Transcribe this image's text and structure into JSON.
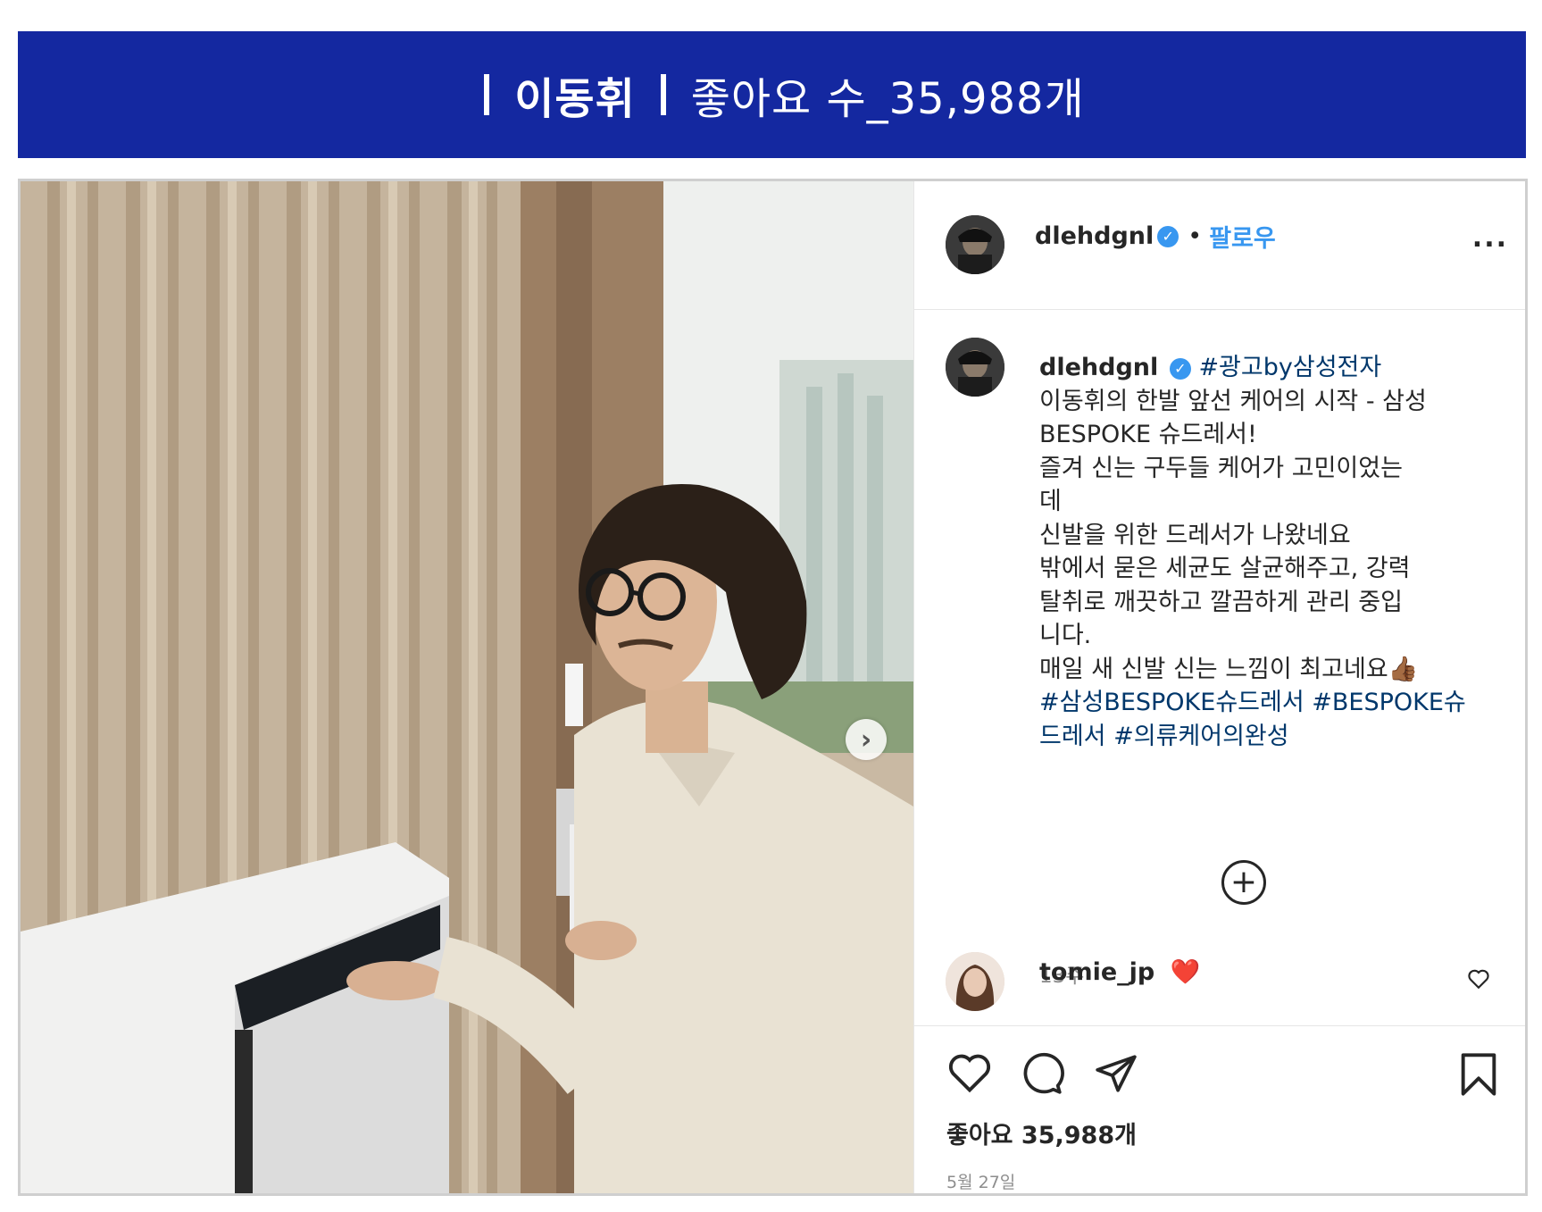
{
  "banner": {
    "name": "이동휘",
    "likes_text": "좋아요 수_35,988개"
  },
  "post": {
    "username": "dlehdgnl",
    "follow_label": "팔로우",
    "more_label": "...",
    "caption": {
      "hashtag_ad": "#광고by삼성전자",
      "lines": [
        "이동휘의 한발 앞선 케어의 시작 - 삼성",
        "BESPOKE 슈드레서!",
        "즐겨 신는 구두들 케어가 고민이었는",
        "데",
        "신발을 위한 드레서가 나왔네요",
        "밖에서 묻은 세균도 살균해주고, 강력",
        "탈취로 깨끗하고 깔끔하게 관리 중입",
        "니다.",
        "매일 새 신발 신는 느낌이 최고네요👍🏾"
      ],
      "hashtags_1": "#삼성BESPOKE슈드레서 #BESPOKE슈",
      "hashtags_2": "드레서 #의류케어의완성"
    },
    "time_ago": "13주",
    "comment": {
      "username": "tomie_jp",
      "emoji": "❤️"
    },
    "likes_label": "좋아요 35,988개",
    "date": "5월 27일",
    "colors": {
      "banner": "#1428a0",
      "link": "#3897f0",
      "hashtag": "#00376b"
    }
  }
}
